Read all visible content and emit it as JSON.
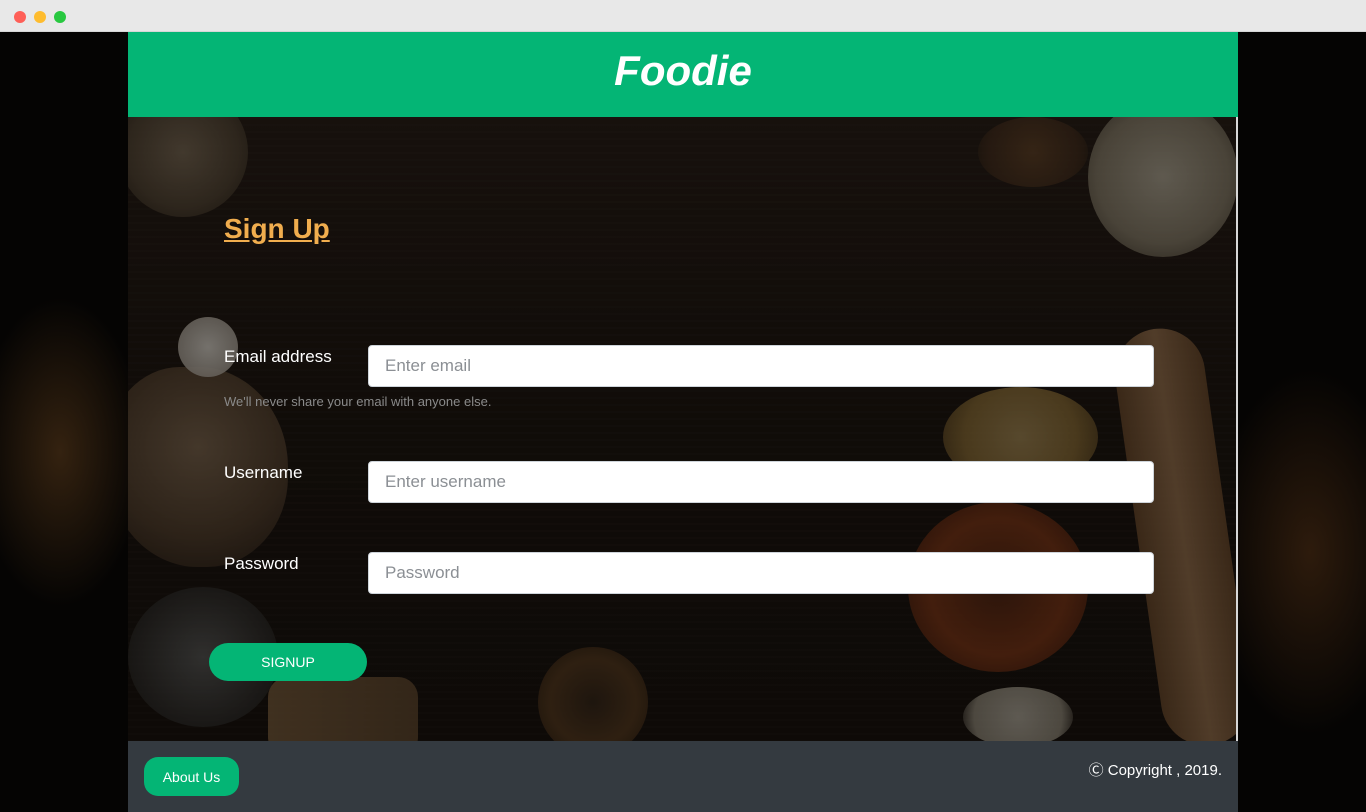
{
  "navbar": {
    "brand": "Foodie"
  },
  "signup": {
    "heading": "Sign Up",
    "email": {
      "label": "Email address",
      "placeholder": "Enter email",
      "help": "We'll never share your email with anyone else."
    },
    "username": {
      "label": "Username",
      "placeholder": "Enter username"
    },
    "password": {
      "label": "Password",
      "placeholder": "Password"
    },
    "submit_label": "SIGNUP"
  },
  "footer": {
    "about_label": "About Us",
    "copyright": "Ⓒ Copyright , 2019."
  },
  "colors": {
    "accent": "#04b575",
    "heading": "#f0ad4e",
    "footer_bg": "#343a40"
  }
}
